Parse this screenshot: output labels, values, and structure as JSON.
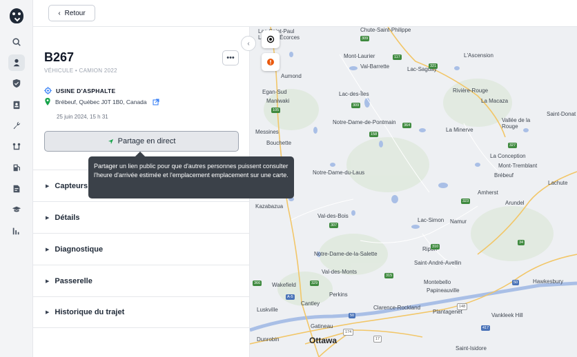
{
  "nav": {
    "items": [
      {
        "name": "search-icon"
      },
      {
        "name": "map-pin-user-icon",
        "active": true
      },
      {
        "name": "shield-icon"
      },
      {
        "name": "clipboard-user-icon"
      },
      {
        "name": "wrench-icon"
      },
      {
        "name": "route-icon"
      },
      {
        "name": "fuel-icon"
      },
      {
        "name": "document-icon"
      },
      {
        "name": "graduation-cap-icon"
      },
      {
        "name": "bar-chart-icon"
      }
    ]
  },
  "topbar": {
    "back_label": "Retour"
  },
  "vehicle": {
    "name": "B267",
    "subtitle": "VÉHICULE • CAMION 2022",
    "location_name": "USINE D'ASPHALTE",
    "address": "Brébeuf, Québec J0T 1B0, Canada",
    "timestamp": "25 juin 2024, 15 h 31"
  },
  "share": {
    "label": "Partage en direct",
    "tooltip": "Partager un lien public pour que d'autres personnes puissent consulter l'heure d'arrivée estimée et l'emplacement emplacement sur une carte."
  },
  "sections": [
    "Capteurs",
    "Détails",
    "Diagnostique",
    "Passerelle",
    "Historique du trajet"
  ],
  "colors": {
    "accent": "#3b82f6",
    "warning": "#ea580c",
    "green_pin": "#16a34a"
  },
  "map": {
    "places": [
      "Lac-Saint-Paul",
      "Chute-Saint-Philippe",
      "Mont-Laurier",
      "Lac-des-Écorces",
      "L'Ascension",
      "Val-Barrette",
      "Lac-Saguay",
      "Aumond",
      "Egan-Sud",
      "Maniwaki",
      "Lac-des-Îles",
      "Rivière-Rouge",
      "La Macaza",
      "Notre-Dame-de-Pontmain",
      "Vallée de la Rouge",
      "Messines",
      "La Minerve",
      "Bouchette",
      "La Conception",
      "Mont-Tremblant",
      "Notre-Dame-du-Laus",
      "Brébeuf",
      "Amherst",
      "Kazabazua",
      "Arundel",
      "Val-des-Bois",
      "Lac-Simon",
      "Namur",
      "Notre-Dame-de-la-Salette",
      "Ripon",
      "Saint-André-Avellin",
      "Wakefield",
      "Val-des-Monts",
      "Montebello",
      "Perkins",
      "Papineauville",
      "Cantley",
      "Clarence-Rockland",
      "Luskville",
      "Plantagenet",
      "Gatineau",
      "Vankleek Hill",
      "Ottawa",
      "Dunrobin",
      "Saint-Isidore",
      "Saint-Donat",
      "Lachute",
      "Hawkesbury"
    ],
    "route_shields": [
      "309",
      "117",
      "105",
      "321",
      "327",
      "323",
      "307",
      "366",
      "A-5",
      "315",
      "50",
      "148",
      "174",
      "417",
      "17",
      "34",
      "329",
      "158",
      "364",
      "310",
      "309",
      "50"
    ]
  }
}
